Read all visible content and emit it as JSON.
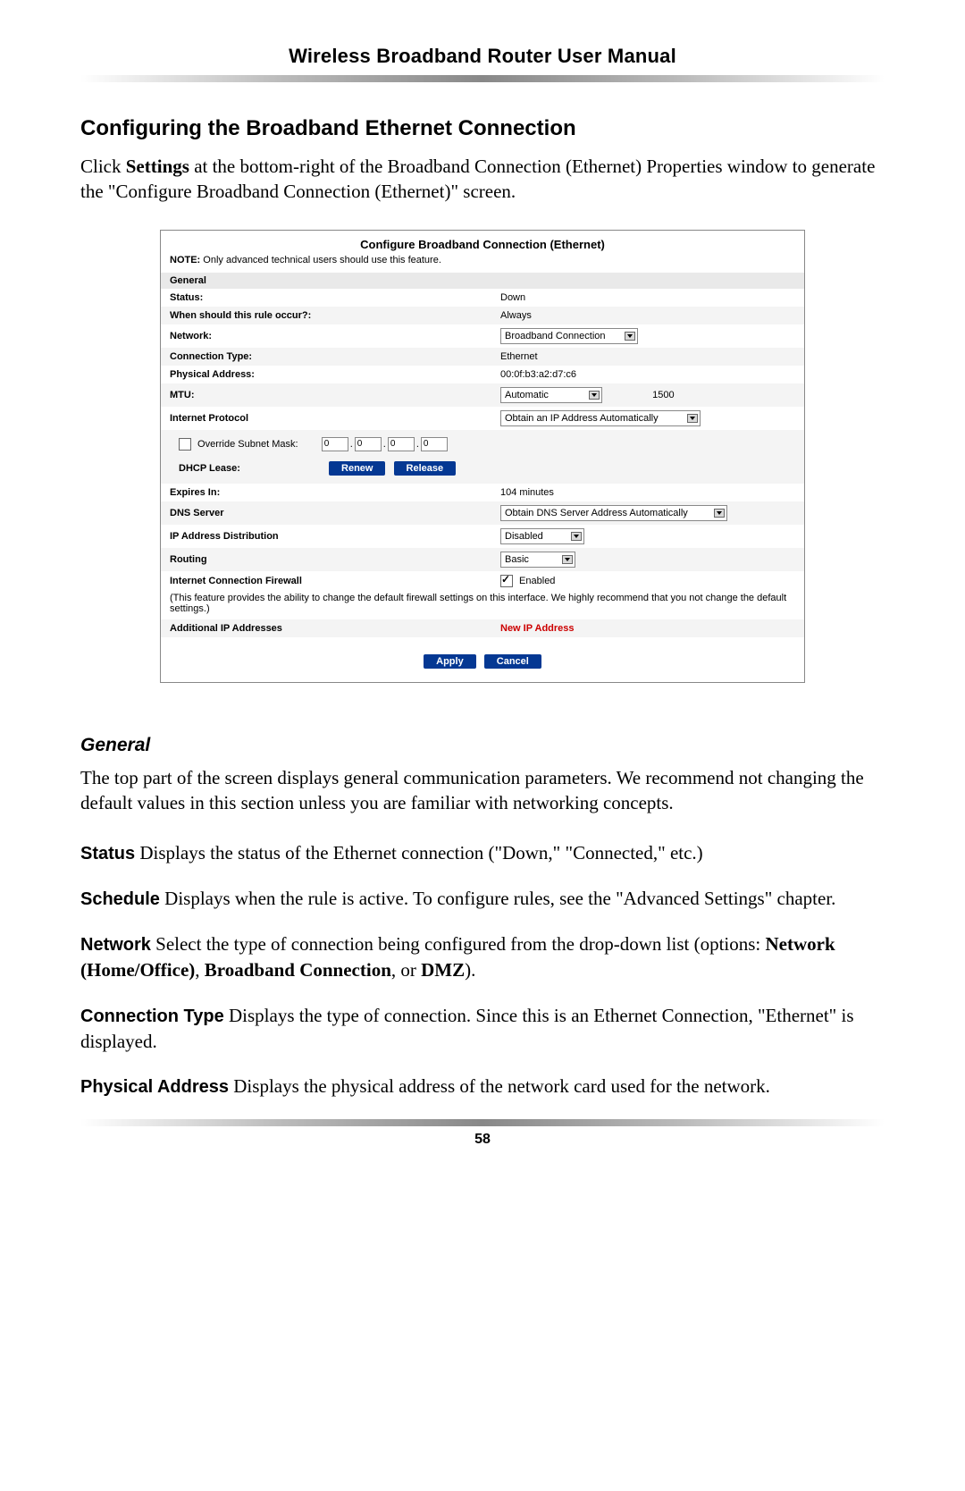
{
  "header": {
    "title": "Wireless Broadband Router User Manual"
  },
  "section": {
    "heading": "Configuring the Broadband Ethernet Connection",
    "intro_pre": "Click ",
    "intro_bold": "Settings",
    "intro_post": " at the bottom-right of the Broadband Connection (Ethernet) Properties window to generate the \"Configure Broadband Connection (Ethernet)\" screen."
  },
  "panel": {
    "title": "Configure Broadband Connection (Ethernet)",
    "note_label": "NOTE:",
    "note_text": " Only advanced technical users should use this feature.",
    "general_header": "General",
    "status_label": "Status:",
    "status_value": "Down",
    "rule_label": "When should this rule occur?:",
    "rule_value": "Always",
    "network_label": "Network:",
    "network_value": "Broadband Connection",
    "conn_type_label": "Connection Type:",
    "conn_type_value": "Ethernet",
    "phys_label": "Physical Address:",
    "phys_value": "00:0f:b3:a2:d7:c6",
    "mtu_label": "MTU:",
    "mtu_select": "Automatic",
    "mtu_value": "1500",
    "ip_proto_label": "Internet Protocol",
    "ip_proto_value": "Obtain an IP Address Automatically",
    "override_label": " Override Subnet Mask:",
    "oct1": "0",
    "oct2": "0",
    "oct3": "0",
    "oct4": "0",
    "dhcp_lease_label": "DHCP Lease:",
    "renew": "Renew",
    "release": "Release",
    "expires_label": "Expires In:",
    "expires_value": "104 minutes",
    "dns_label": "DNS Server",
    "dns_value": "Obtain DNS Server Address Automatically",
    "ipdist_label": "IP Address Distribution",
    "ipdist_value": "Disabled",
    "routing_label": "Routing",
    "routing_value": "Basic",
    "firewall_label": "Internet Connection Firewall",
    "firewall_enabled": " Enabled",
    "firewall_note": "(This feature provides the ability to change the default firewall settings on this interface. We highly recommend that you not change the default settings.)",
    "addl_ip_label": "Additional IP Addresses",
    "new_ip": "New IP Address",
    "apply": "Apply",
    "cancel": "Cancel"
  },
  "general": {
    "heading": "General",
    "intro": "The top part of the screen displays general communication parameters. We recommend not changing the default values in this section unless you are familiar with networking concepts.",
    "status_label": "Status",
    "status_text": "  Displays the status of the Ethernet connection (\"Down,\" \"Connected,\" etc.)",
    "schedule_label": "Schedule",
    "schedule_text": "  Displays when the rule is active. To configure rules, see the \"Advanced Settings\" chapter.",
    "network_label": "Network",
    "network_text_pre": "  Select the type of connection being configured from the drop-down list (options: ",
    "network_opt1": "Network (Home/Office)",
    "network_sep1": ", ",
    "network_opt2": "Broadband Connection",
    "network_sep2": ", or ",
    "network_opt3": "DMZ",
    "network_text_post": ").",
    "conntype_label": "Connection Type",
    "conntype_text": "  Displays the type of connection. Since this is an Ethernet Connection, \"Ethernet\" is displayed.",
    "phys_label": "Physical Address",
    "phys_text": "  Displays the physical address of the network card used for the network."
  },
  "page_number": "58"
}
